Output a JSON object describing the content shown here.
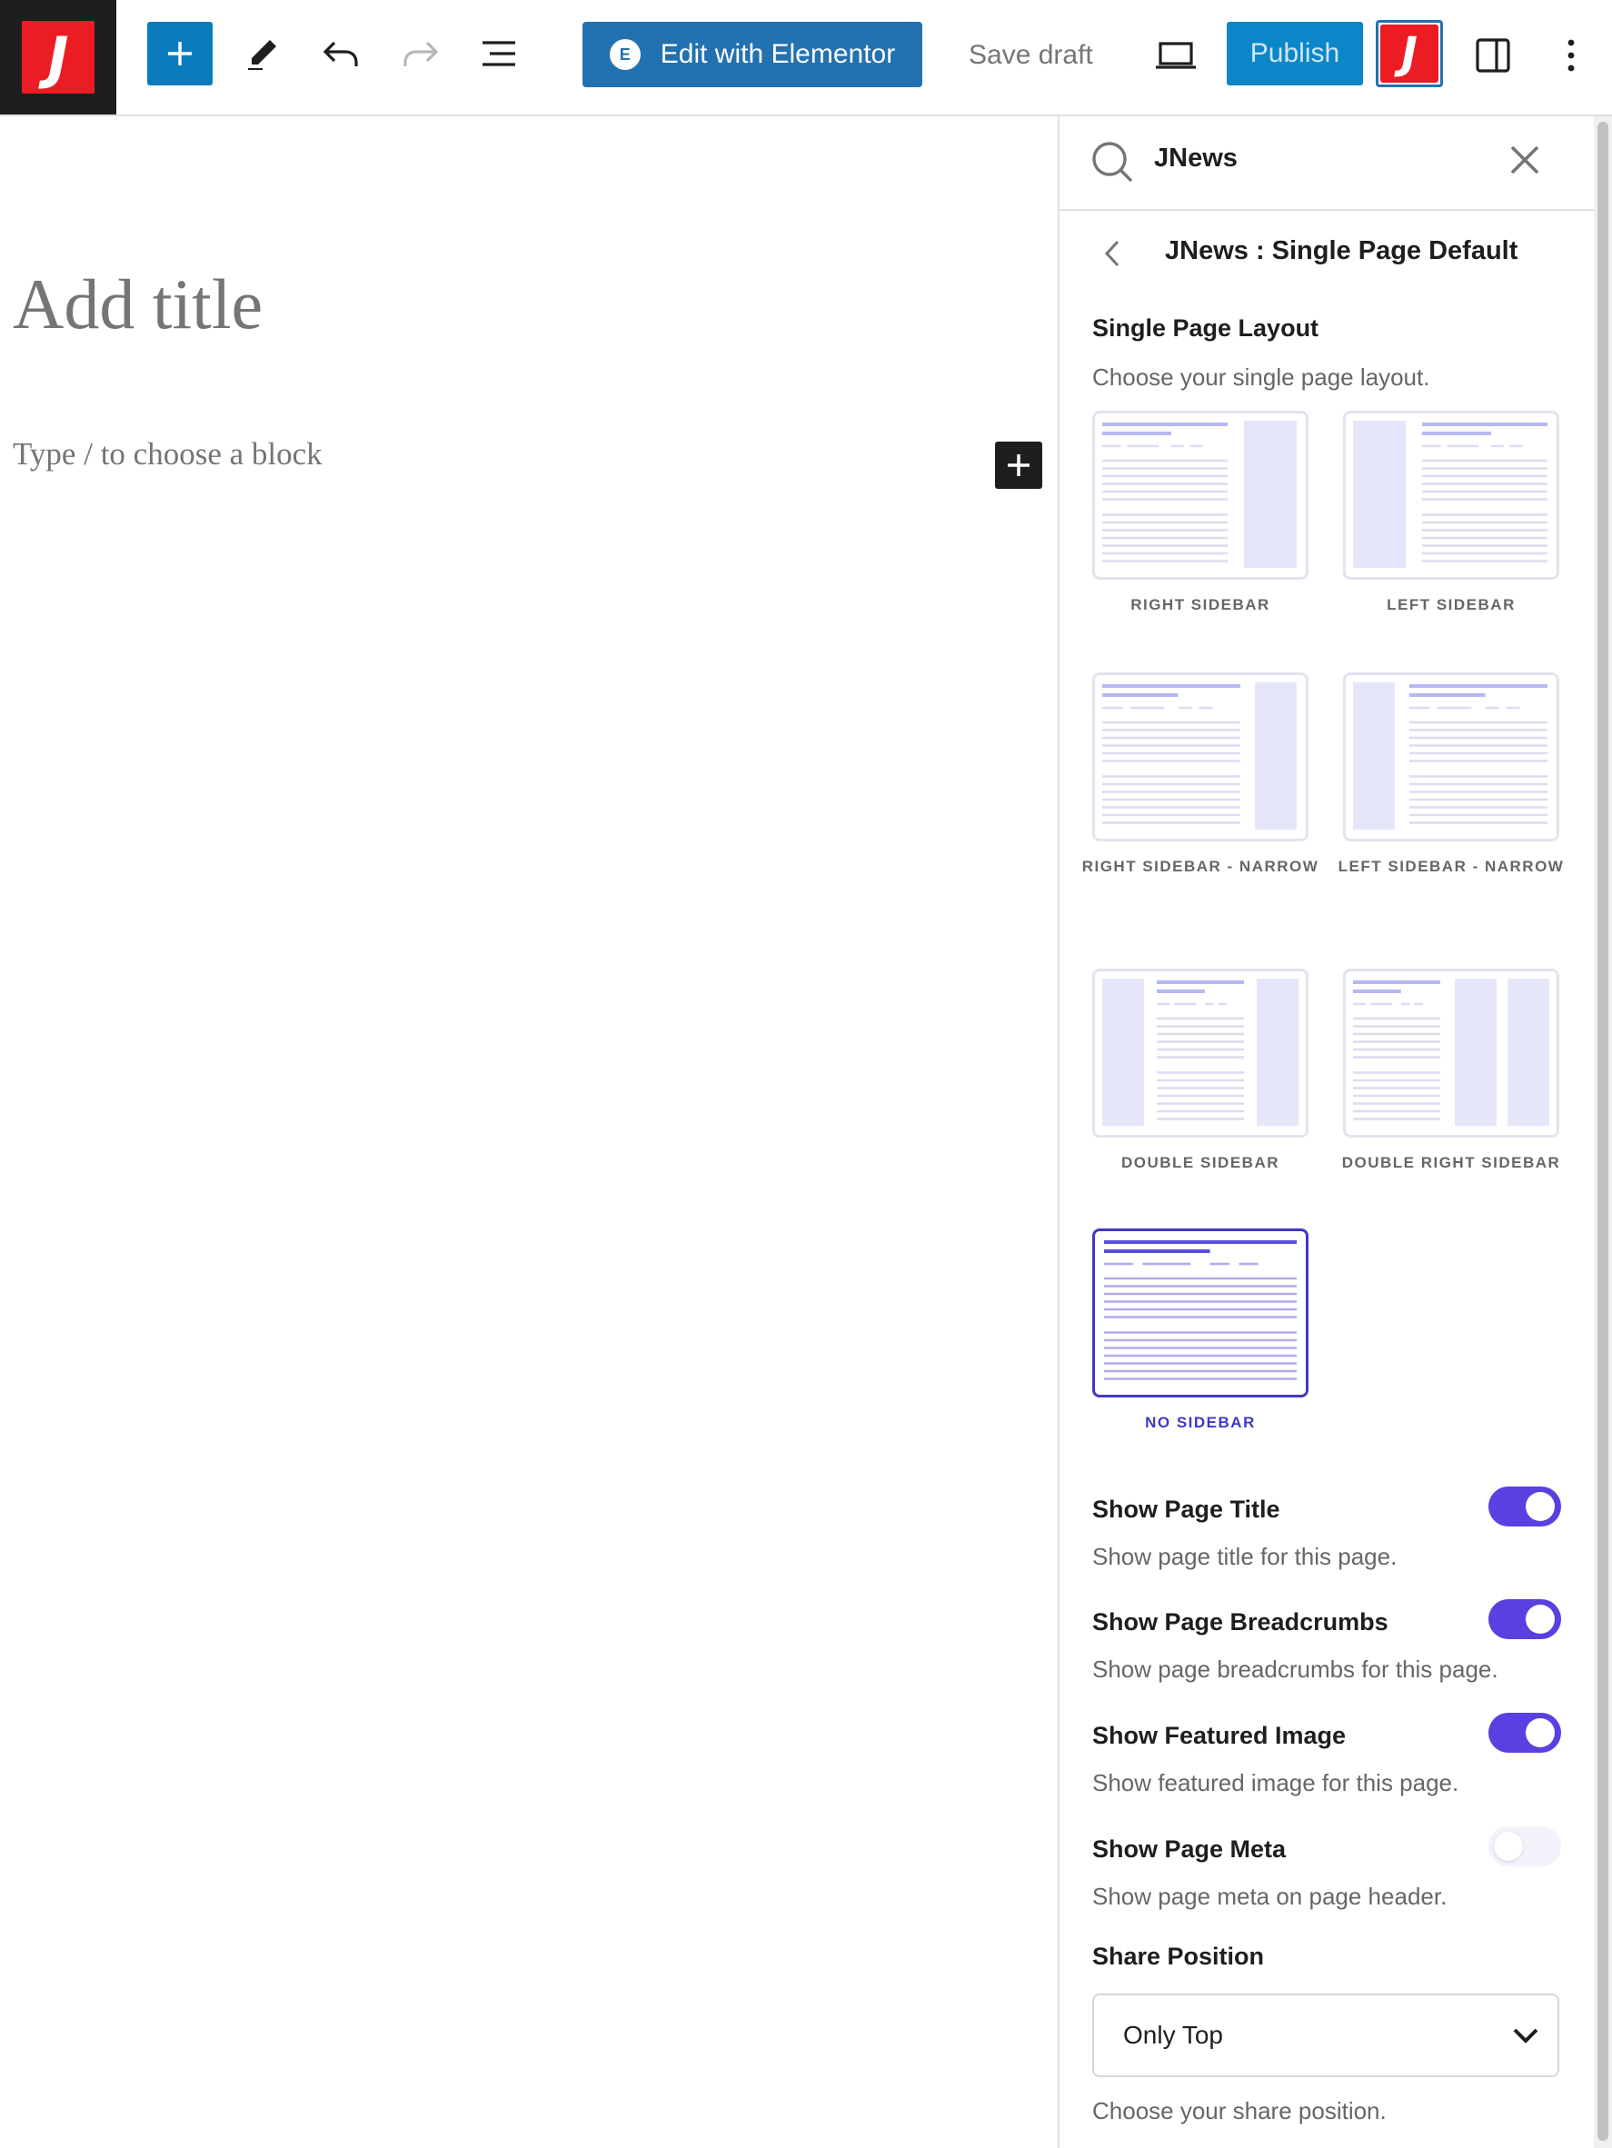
{
  "toolbar": {
    "elementor_label": "Edit with Elementor",
    "save_draft_label": "Save draft",
    "publish_label": "Publish",
    "logo_letter": "J",
    "jnews_letter": "J",
    "elementor_icon_glyph": "E"
  },
  "editor": {
    "title_placeholder": "Add title",
    "block_placeholder": "Type / to choose a block"
  },
  "sidebar": {
    "search_query": "JNews",
    "panel_title": "JNews : Single Page Default",
    "layout_section": {
      "label": "Single Page Layout",
      "description": "Choose your single page layout.",
      "options": [
        {
          "caption": "RIGHT SIDEBAR",
          "selected": false
        },
        {
          "caption": "LEFT SIDEBAR",
          "selected": false
        },
        {
          "caption": "RIGHT SIDEBAR - NARROW",
          "selected": false
        },
        {
          "caption": "LEFT SIDEBAR - NARROW",
          "selected": false
        },
        {
          "caption": "DOUBLE SIDEBAR",
          "selected": false
        },
        {
          "caption": "DOUBLE RIGHT SIDEBAR",
          "selected": false
        },
        {
          "caption": "NO SIDEBAR",
          "selected": true
        }
      ]
    },
    "toggles": [
      {
        "label": "Show Page Title",
        "description": "Show page title for this page.",
        "on": true
      },
      {
        "label": "Show Page Breadcrumbs",
        "description": "Show page breadcrumbs for this page.",
        "on": true
      },
      {
        "label": "Show Featured Image",
        "description": "Show featured image for this page.",
        "on": true
      },
      {
        "label": "Show Page Meta",
        "description": "Show page meta on page header.",
        "on": false
      }
    ],
    "share_position": {
      "label": "Share Position",
      "value": "Only Top",
      "description": "Choose your share position."
    }
  },
  "colors": {
    "primary_blue": "#2271b1",
    "jnews_red": "#ec1c24",
    "toggle_on": "#5b3fe0",
    "selected_layout": "#4038c9"
  },
  "icons": [
    "plus-icon",
    "pencil-icon",
    "undo-icon",
    "redo-icon",
    "list-view-icon",
    "desktop-preview-icon",
    "settings-panel-icon",
    "more-options-icon",
    "search-icon",
    "close-icon",
    "chevron-left-icon",
    "chevron-down-icon"
  ]
}
